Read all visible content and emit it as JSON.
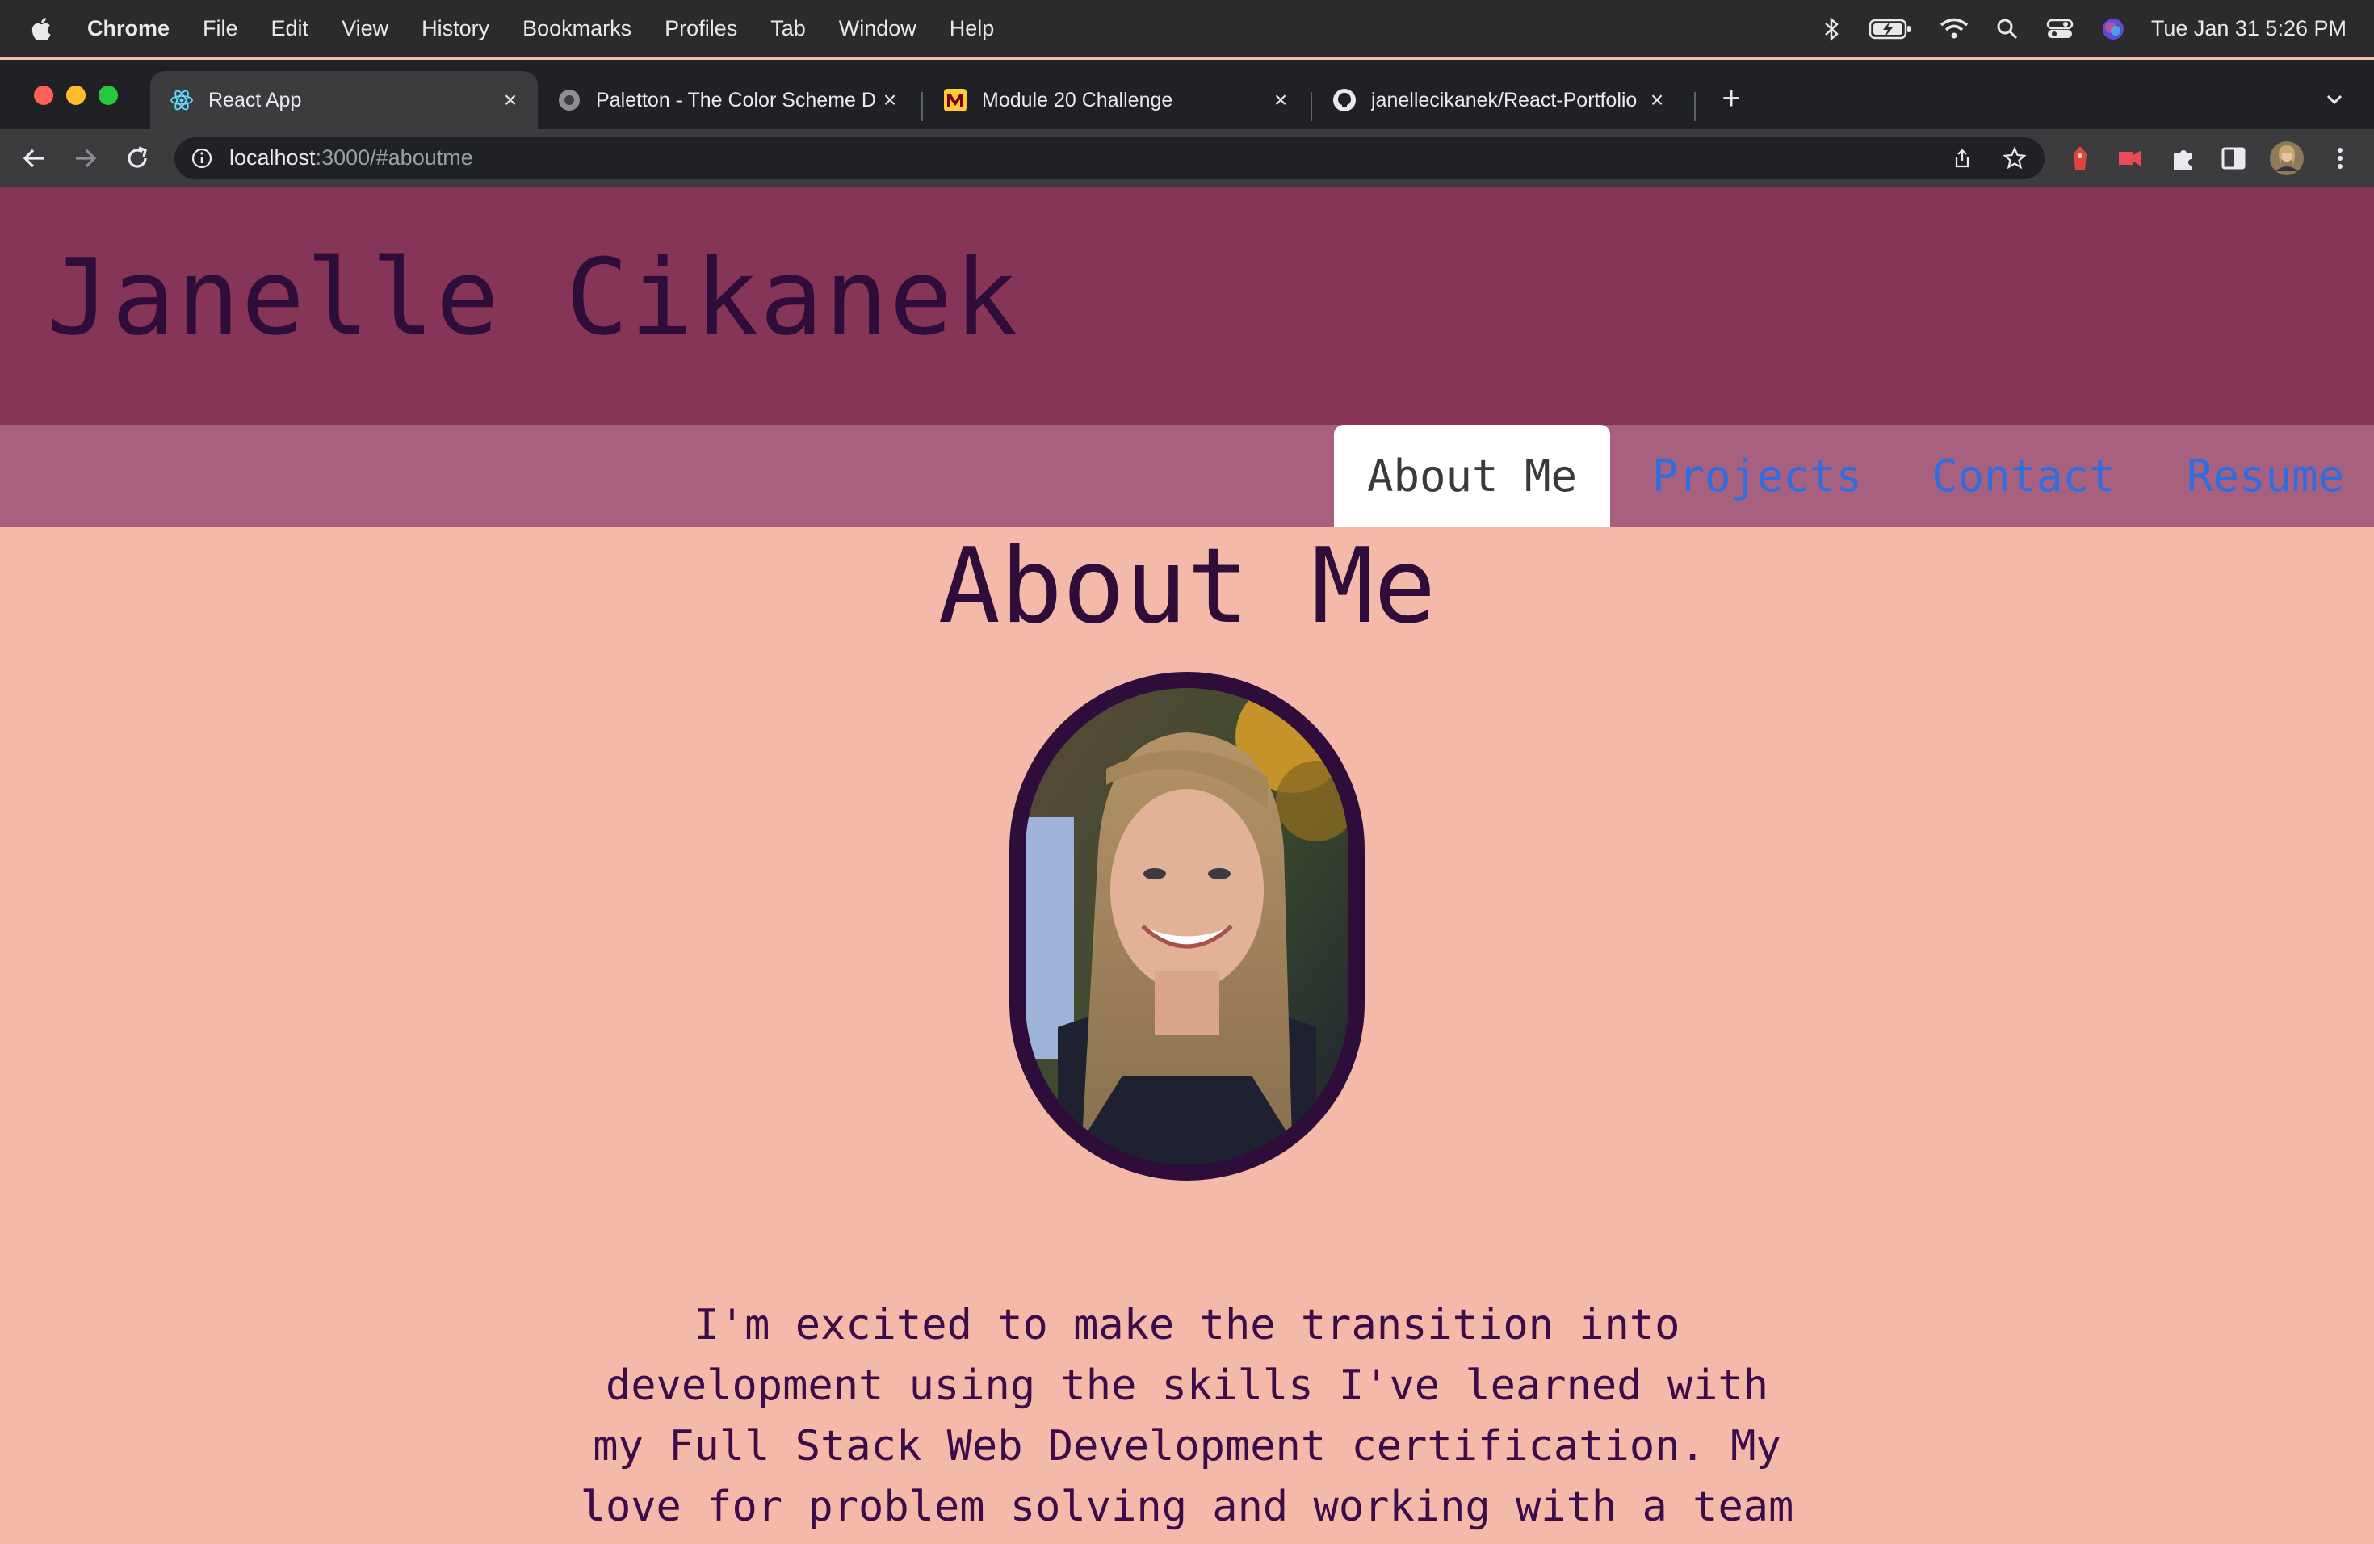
{
  "menubar": {
    "app": "Chrome",
    "items": [
      "File",
      "Edit",
      "View",
      "History",
      "Bookmarks",
      "Profiles",
      "Tab",
      "Window",
      "Help"
    ],
    "clock": "Tue Jan 31  5:26 PM"
  },
  "browser": {
    "tabs": [
      {
        "title": "React App",
        "icon": "react-icon",
        "active": true
      },
      {
        "title": "Paletton - The Color Scheme D",
        "icon": "paletton-icon",
        "active": false
      },
      {
        "title": "Module 20 Challenge",
        "icon": "umn-icon",
        "active": false
      },
      {
        "title": "janellecikanek/React-Portfolio",
        "icon": "github-icon",
        "active": false
      }
    ],
    "url_host": "localhost",
    "url_rest": ":3000/#aboutme"
  },
  "site": {
    "name": "Janelle Cikanek",
    "nav": [
      {
        "label": "About Me",
        "active": true
      },
      {
        "label": "Projects",
        "active": false
      },
      {
        "label": "Contact",
        "active": false
      },
      {
        "label": "Resume",
        "active": false
      }
    ],
    "about_title": "About Me",
    "bio_lines": [
      "I'm excited to make the transition into",
      "development using the skills I've learned with",
      "my Full Stack Web Development certification. My",
      "love for problem solving and working with a team"
    ]
  },
  "colors": {
    "header": "#873557",
    "nav": "#a8607f",
    "page": "#f4b9a8",
    "text": "#2f0d3a",
    "link": "#2e6ee0"
  }
}
